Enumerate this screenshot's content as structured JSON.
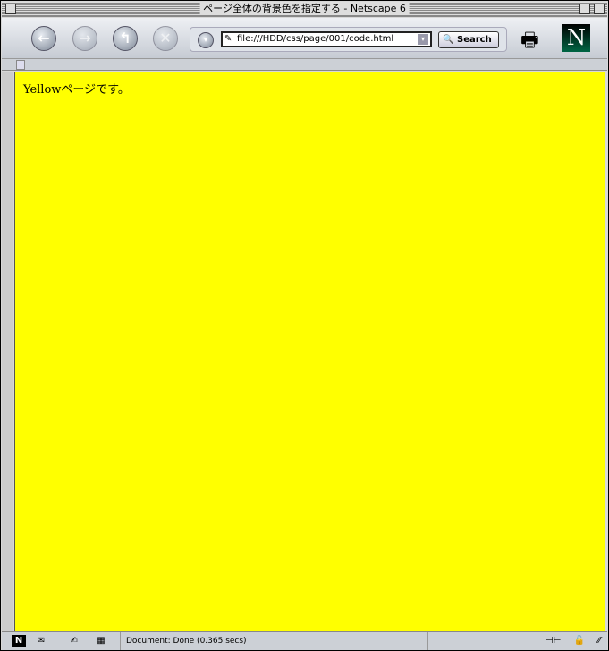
{
  "window": {
    "title": "ページ全体の背景色を指定する - Netscape 6"
  },
  "toolbar": {
    "url": "file:///HDD/css/page/001/code.html",
    "search_label": "Search",
    "logo": "N"
  },
  "content": {
    "text": "Yellowページです。",
    "background": "#ffff00"
  },
  "status": {
    "text": "Document: Done (0.365 secs)"
  }
}
